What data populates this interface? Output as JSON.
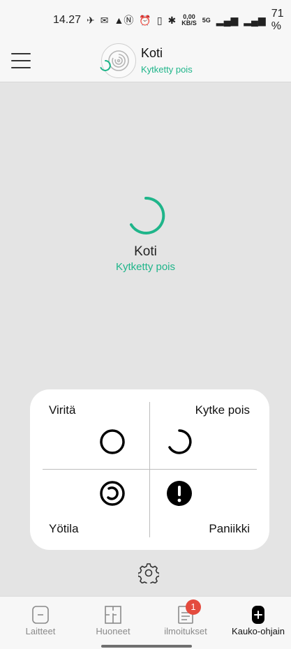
{
  "status_bar": {
    "time": "14.27",
    "network_speed_value": "0,00",
    "network_speed_unit": "KB/S",
    "network_type": "5G",
    "battery": "71 %"
  },
  "header": {
    "site_name": "Koti",
    "site_status": "Kytketty pois"
  },
  "main": {
    "title": "Koti",
    "status": "Kytketty pois"
  },
  "controls": {
    "arm": "Viritä",
    "disarm": "Kytke pois",
    "night": "Yötila",
    "panic": "Paniikki"
  },
  "nav": {
    "devices": "Laitteet",
    "rooms": "Huoneet",
    "notifications": "ilmoitukset",
    "notification_count": "1",
    "remote": "Kauko-ohjain"
  },
  "colors": {
    "accent": "#1fb58a",
    "badge": "#e44b3e"
  }
}
